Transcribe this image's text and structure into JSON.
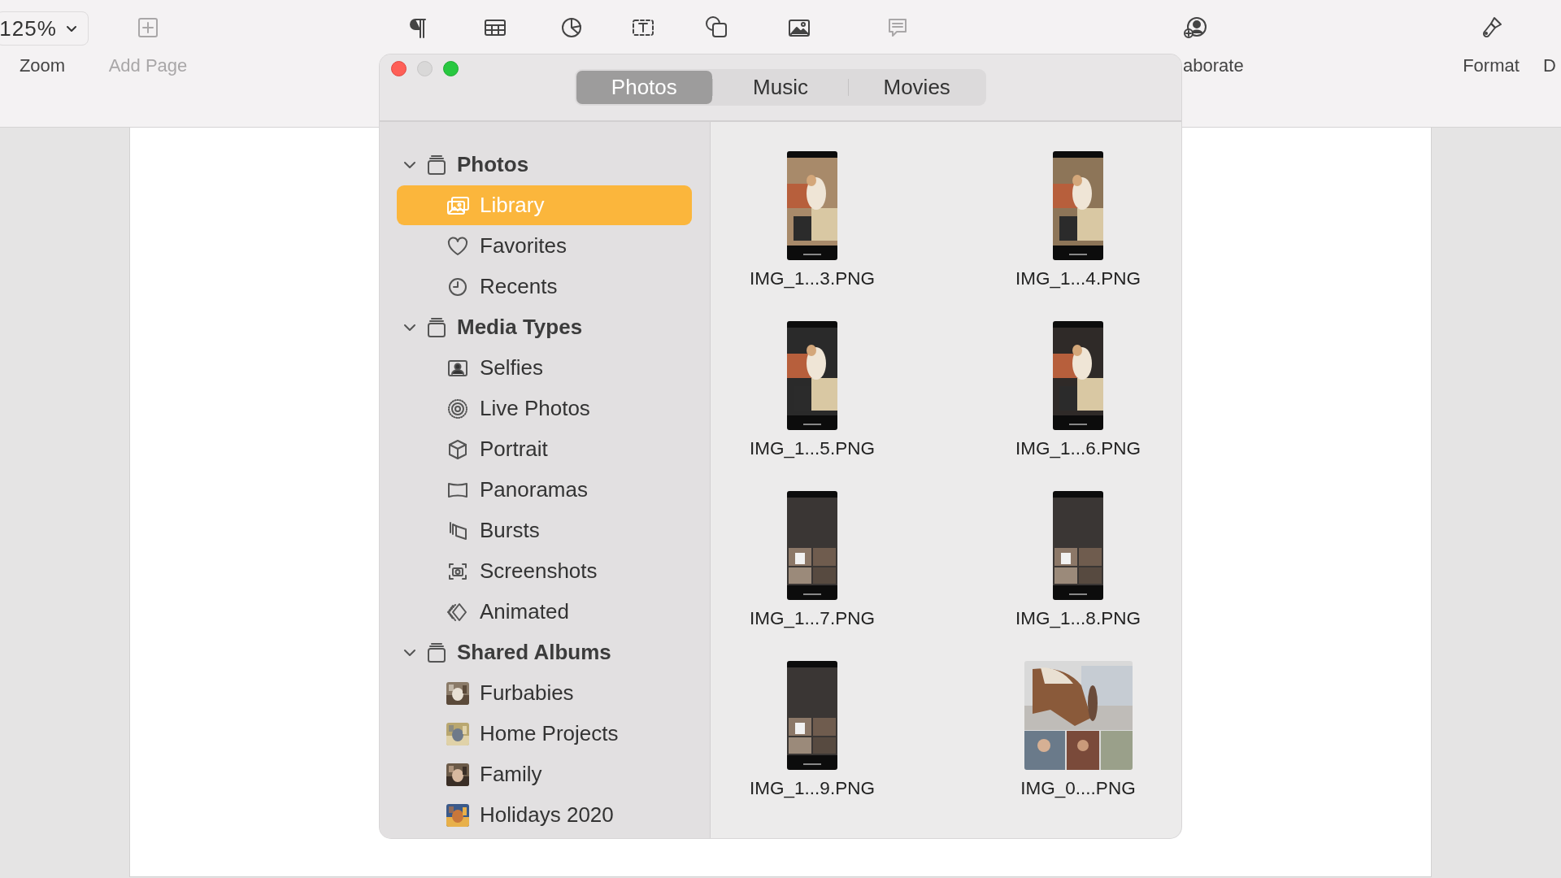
{
  "toolbar": [
    {
      "kind": "dropdown",
      "value": "125%",
      "label": "Zoom",
      "disabled": false
    },
    {
      "kind": "button",
      "label": "Add Page",
      "disabled": true
    },
    {
      "kind": "icon",
      "disabled": false
    },
    {
      "kind": "icon",
      "disabled": false
    },
    {
      "kind": "icon",
      "disabled": false
    },
    {
      "kind": "icon",
      "disabled": false
    },
    {
      "kind": "icon",
      "disabled": false
    },
    {
      "kind": "icon",
      "disabled": false
    },
    {
      "kind": "icon",
      "disabled": true
    },
    {
      "kind": "button",
      "label": "aborate",
      "disabled": false
    },
    {
      "kind": "button",
      "label": "Format",
      "disabled": false
    },
    {
      "kind": "button",
      "label": "D",
      "disabled": false
    }
  ],
  "browser": {
    "tabs": [
      {
        "label": "Photos",
        "selected": true
      },
      {
        "label": "Music",
        "selected": false
      },
      {
        "label": "Movies",
        "selected": false
      }
    ],
    "sidebar": [
      {
        "label": "Photos",
        "expanded": true,
        "items": [
          {
            "label": "Library",
            "selected": true,
            "kind": "icon"
          },
          {
            "label": "Favorites",
            "selected": false,
            "kind": "icon"
          },
          {
            "label": "Recents",
            "selected": false,
            "kind": "icon"
          }
        ]
      },
      {
        "label": "Media Types",
        "expanded": true,
        "items": [
          {
            "label": "Selfies",
            "selected": false,
            "kind": "icon"
          },
          {
            "label": "Live Photos",
            "selected": false,
            "kind": "icon"
          },
          {
            "label": "Portrait",
            "selected": false,
            "kind": "icon"
          },
          {
            "label": "Panoramas",
            "selected": false,
            "kind": "icon"
          },
          {
            "label": "Bursts",
            "selected": false,
            "kind": "icon"
          },
          {
            "label": "Screenshots",
            "selected": false,
            "kind": "icon"
          },
          {
            "label": "Animated",
            "selected": false,
            "kind": "icon"
          }
        ]
      },
      {
        "label": "Shared Albums",
        "expanded": true,
        "items": [
          {
            "label": "Furbabies",
            "selected": false,
            "kind": "picture"
          },
          {
            "label": "Home Projects",
            "selected": false,
            "kind": "picture"
          },
          {
            "label": "Family",
            "selected": false,
            "kind": "picture"
          },
          {
            "label": "Holidays 2020",
            "selected": false,
            "kind": "picture"
          }
        ]
      }
    ],
    "files": [
      {
        "name": "IMG_1...3.PNG",
        "kind": "portrait"
      },
      {
        "name": "IMG_1...4.PNG",
        "kind": "portrait"
      },
      {
        "name": "IMG_1...5.PNG",
        "kind": "portrait"
      },
      {
        "name": "IMG_1...6.PNG",
        "kind": "portrait"
      },
      {
        "name": "IMG_1...7.PNG",
        "kind": "portrait"
      },
      {
        "name": "IMG_1...8.PNG",
        "kind": "portrait"
      },
      {
        "name": "IMG_1...9.PNG",
        "kind": "portrait"
      },
      {
        "name": "IMG_0....PNG",
        "kind": "landscape"
      }
    ]
  }
}
